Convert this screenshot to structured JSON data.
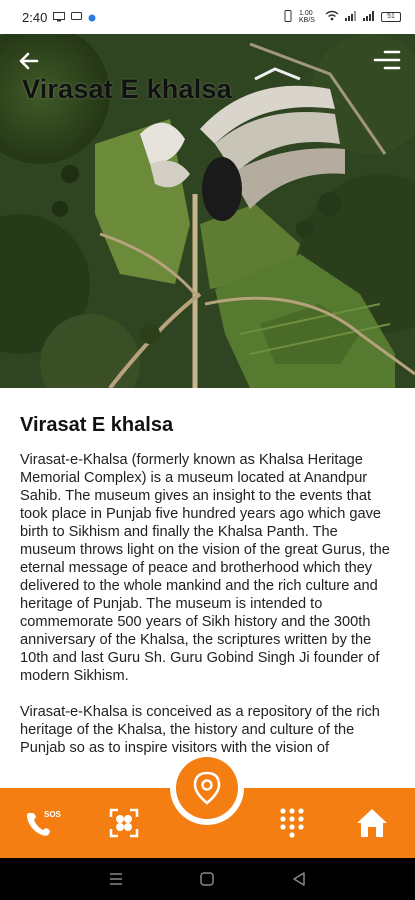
{
  "status_bar": {
    "time": "2:40",
    "speed": "1.00 KB/S",
    "battery": "51"
  },
  "header": {
    "title": "Virasat E khalsa"
  },
  "article": {
    "heading": "Virasat E khalsa",
    "paragraphs": [
      "Virasat-e-Khalsa (formerly known as Khalsa Heritage Memorial Complex) is a museum located at Anandpur Sahib. The museum gives an insight to the events that took place in Punjab five hundred years ago which gave birth to Sikhism and finally the Khalsa Panth. The museum throws light on the vision of the great Gurus, the eternal message of peace and brotherhood which they delivered to the whole mankind and the rich culture and heritage of Punjab. The museum is intended to commemorate 500 years of Sikh history and the 300th anniversary of the Khalsa, the scriptures written by the 10th and last Guru Sh. Guru Gobind Singh Ji founder of modern Sikhism.",
      "Virasat-e-Khalsa is conceived as a repository of the rich heritage of the Khalsa, the history and culture of the Punjab so as to inspire visitors with the vision of"
    ]
  },
  "bottom_nav": {
    "sos_label": "SOS",
    "items": [
      "sos-call-icon",
      "scan-icon",
      "location-pin-icon",
      "dialpad-icon",
      "home-icon"
    ]
  },
  "colors": {
    "accent": "#f47e12",
    "background": "#ffffff"
  }
}
